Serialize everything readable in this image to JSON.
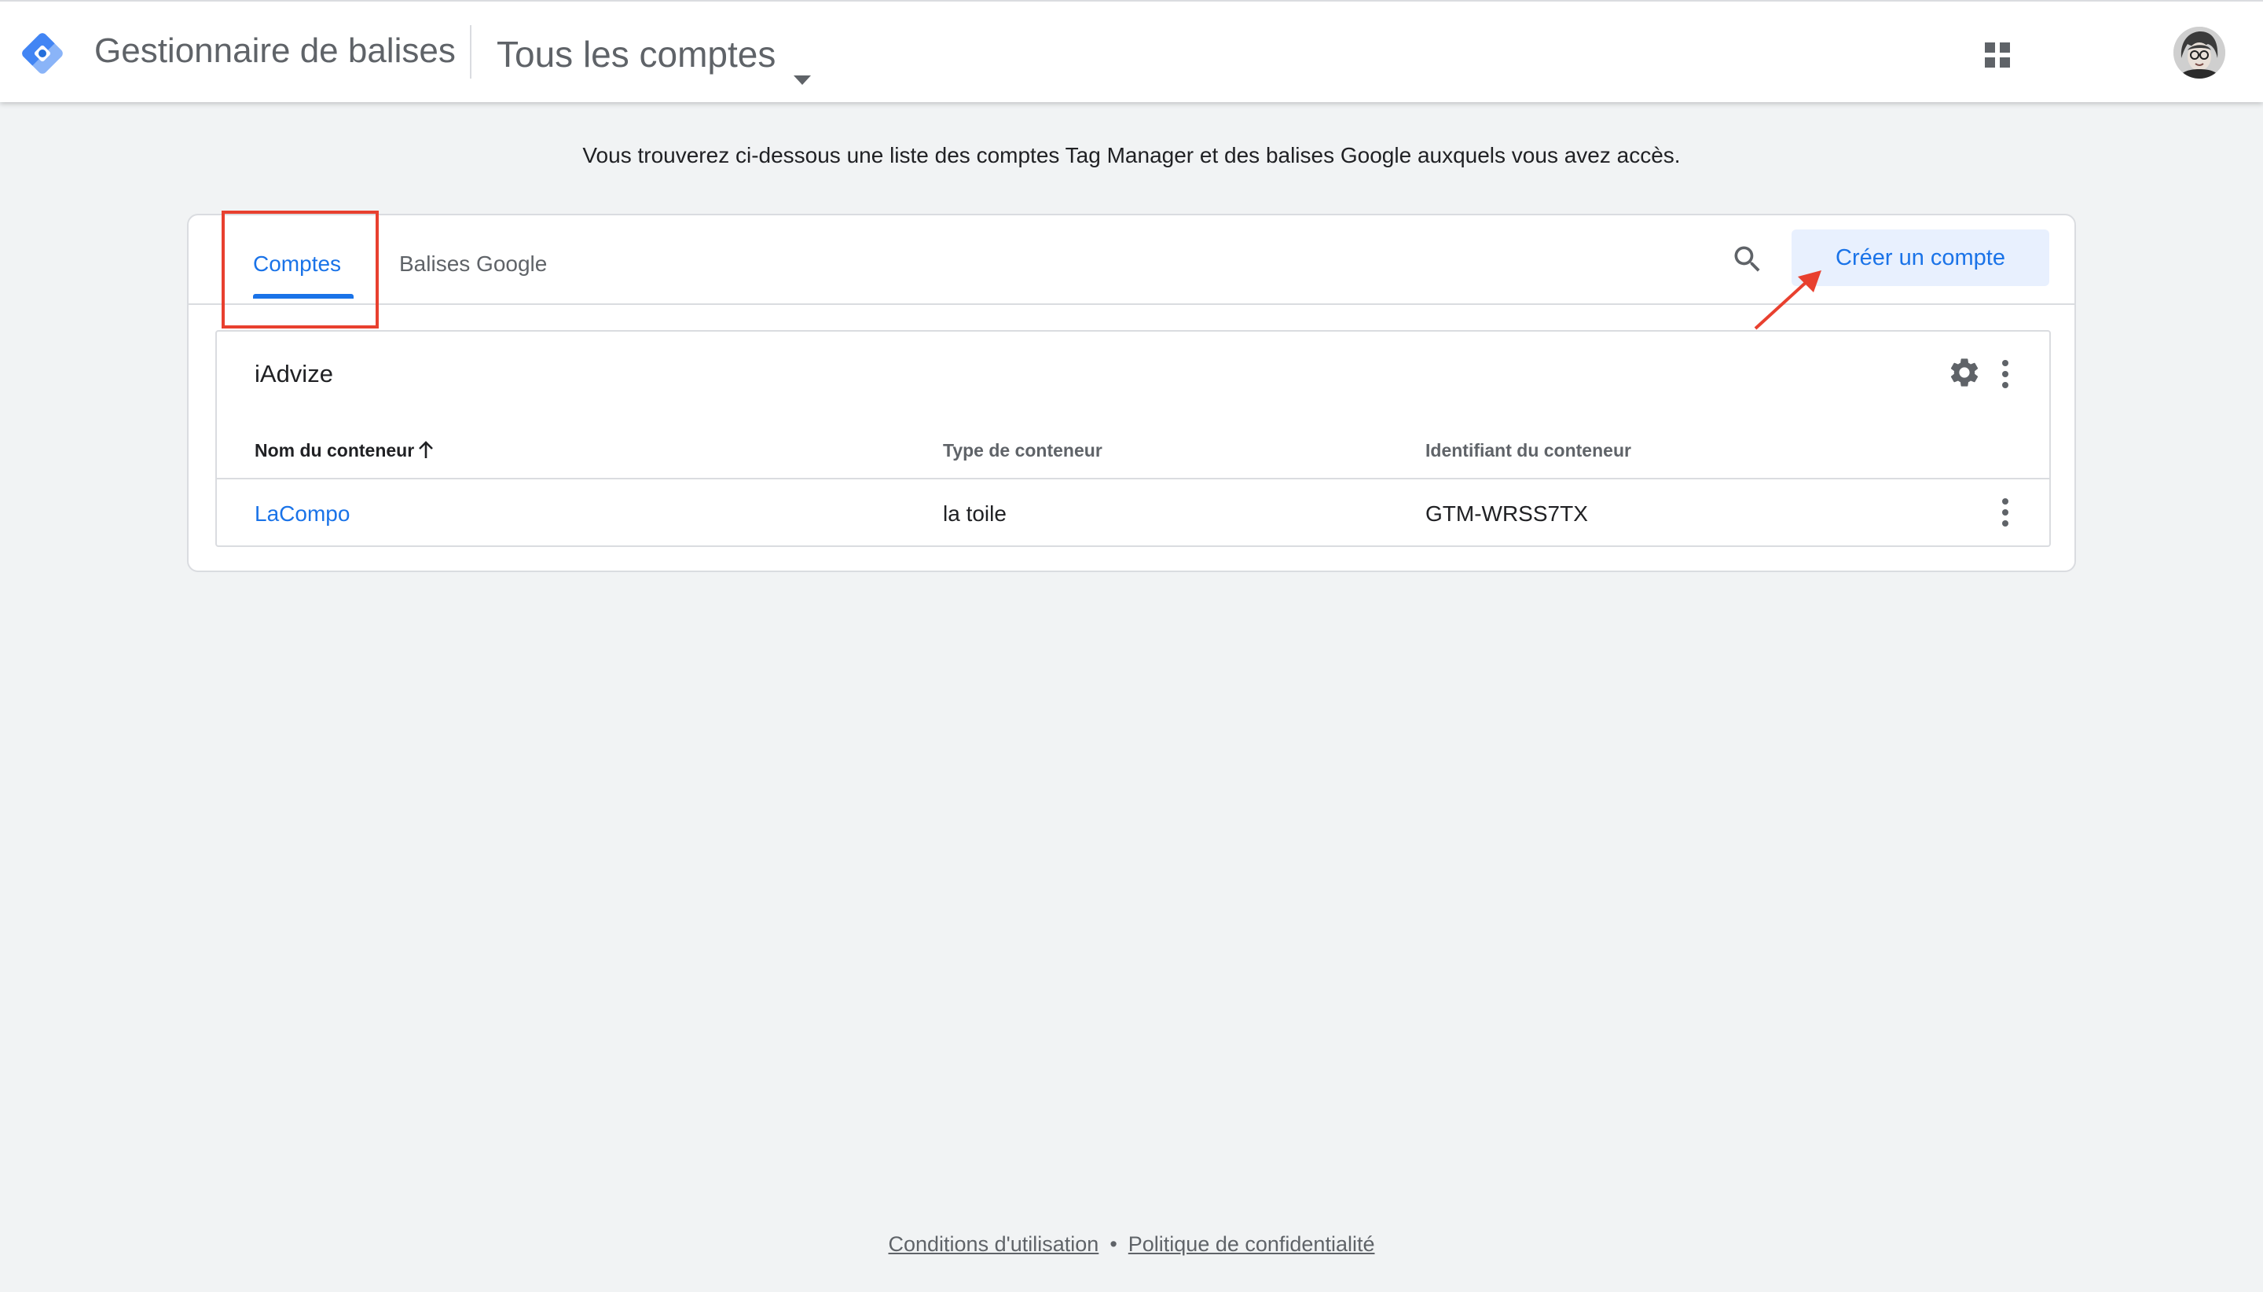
{
  "header": {
    "product_name": "Gestionnaire de balises",
    "account_picker_label": "Tous les comptes"
  },
  "intro_text": "Vous trouverez ci-dessous une liste des comptes Tag Manager et des balises Google auxquels vous avez accès.",
  "tabs": [
    {
      "label": "Comptes",
      "active": true
    },
    {
      "label": "Balises Google",
      "active": false
    }
  ],
  "toolbar": {
    "create_button_label": "Créer un compte"
  },
  "account": {
    "name": "iAdvize",
    "columns": {
      "name": "Nom du conteneur",
      "type": "Type de conteneur",
      "id": "Identifiant du conteneur"
    },
    "containers": [
      {
        "name": "LaCompo",
        "type": "la toile",
        "id": "GTM-WRSS7TX"
      }
    ]
  },
  "footer": {
    "terms": "Conditions d'utilisation",
    "separator": "•",
    "privacy": "Politique de confidentialité"
  },
  "colors": {
    "accent": "#1a73e8",
    "annotation": "#e8402f",
    "background": "#f1f3f4"
  },
  "icons": [
    "tag-manager-logo-icon",
    "caret-down-icon",
    "apps-grid-icon",
    "search-icon",
    "gear-icon",
    "more-vert-icon",
    "arrow-up-icon"
  ]
}
